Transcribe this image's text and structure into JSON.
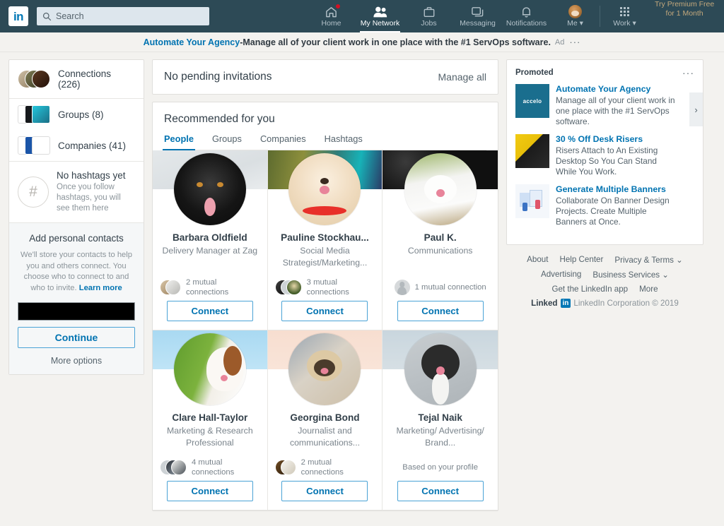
{
  "nav": {
    "logo_text": "in",
    "search_placeholder": "Search",
    "search_value": "",
    "items": [
      {
        "label": "Home",
        "icon": "home-icon",
        "badge": true,
        "active": false
      },
      {
        "label": "My Network",
        "icon": "people-icon",
        "badge": false,
        "active": true
      },
      {
        "label": "Jobs",
        "icon": "briefcase-icon",
        "badge": false,
        "active": false
      },
      {
        "label": "Messaging",
        "icon": "message-icon",
        "badge": false,
        "active": false
      },
      {
        "label": "Notifications",
        "icon": "bell-icon",
        "badge": false,
        "active": false
      },
      {
        "label": "Me ▾",
        "icon": "avatar-icon",
        "badge": false,
        "active": false
      },
      {
        "label": "Work ▾",
        "icon": "grid-icon",
        "badge": false,
        "active": false
      }
    ],
    "premium_line1": "Try Premium Free",
    "premium_line2": "for 1 Month"
  },
  "ad_banner": {
    "link_text": "Automate Your Agency",
    "separator": " - ",
    "body_text": "Manage all of your client work in one place with the #1 ServOps software.",
    "tag": "Ad",
    "menu": "···"
  },
  "sidebar": {
    "connections": {
      "label": "Connections (226)"
    },
    "groups": {
      "label": "Groups (8)"
    },
    "companies": {
      "label": "Companies (41)"
    },
    "hashtags": {
      "icon_glyph": "#",
      "title": "No hashtags yet",
      "subtitle": "Once you follow hashtags, you will see them here"
    },
    "contacts": {
      "title": "Add personal contacts",
      "body": "We'll store your contacts to help you and others connect. You choose who to connect to and who to invite.",
      "learn_more": "Learn more",
      "email_value": "",
      "email_placeholder": "",
      "continue_label": "Continue",
      "more_options_label": "More options"
    }
  },
  "main": {
    "invitations": {
      "title": "No pending invitations",
      "manage_all_label": "Manage all"
    },
    "recommended": {
      "title": "Recommended for you",
      "tabs": [
        {
          "label": "People",
          "active": true
        },
        {
          "label": "Groups",
          "active": false
        },
        {
          "label": "Companies",
          "active": false
        },
        {
          "label": "Hashtags",
          "active": false
        }
      ],
      "people": [
        {
          "name": "Barbara Oldfield",
          "headline": "Delivery Manager at Zag",
          "mutual_text": "2 mutual connections",
          "mutual_count": 2,
          "connect_label": "Connect",
          "cover_color": "#dfe3e6",
          "avatar_desc": "black dog photo"
        },
        {
          "name": "Pauline Stockhau...",
          "headline": "Social Media Strategist/Marketing...",
          "mutual_text": "3 mutual connections",
          "mutual_count": 3,
          "connect_label": "Connect",
          "cover_color": "#7d8a56",
          "avatar_desc": "pomeranian dog photo"
        },
        {
          "name": "Paul K.",
          "headline": "Communications",
          "mutual_text": "1 mutual connection",
          "mutual_count": 1,
          "connect_label": "Connect",
          "cover_color": "#1d1d1d",
          "avatar_desc": "white spitz dog photo"
        },
        {
          "name": "Clare Hall-Taylor",
          "headline": "Marketing & Research Professional",
          "mutual_text": "4 mutual connections",
          "mutual_count": 4,
          "connect_label": "Connect",
          "cover_color": "#b4dcf0",
          "avatar_desc": "cavalier spaniel photo"
        },
        {
          "name": "Georgina Bond",
          "headline": "Journalist and communications...",
          "mutual_text": "2 mutual connections",
          "mutual_count": 2,
          "connect_label": "Connect",
          "cover_color": "#f6ddd0",
          "avatar_desc": "pug photo"
        },
        {
          "name": "Tejal Naik",
          "headline": "Marketing/ Advertising/ Brand...",
          "mutual_text": "Based on your profile",
          "mutual_count": 0,
          "connect_label": "Connect",
          "cover_color": "#cdd8de",
          "avatar_desc": "border collie photo"
        }
      ]
    }
  },
  "promoted": {
    "label": "Promoted",
    "menu": "···",
    "next_arrow": "›",
    "items": [
      {
        "title": "Automate Your Agency",
        "desc": "Manage all of your client work in one place with the #1 ServOps software.",
        "thumb_label": "accelo",
        "thumb_color": "#1a6e8e"
      },
      {
        "title": "30 % Off Desk Risers",
        "desc": "Risers Attach to An Existing Desktop So You Can Stand While You Work.",
        "thumb_label": "",
        "thumb_color": "#f2cb12"
      },
      {
        "title": "Generate Multiple Banners",
        "desc": "Collaborate On Banner Design Projects. Create Multiple Banners at Once.",
        "thumb_label": "",
        "thumb_color": "#eef3fa"
      }
    ]
  },
  "footer": {
    "row1": [
      "About",
      "Help Center",
      "Privacy & Terms ⌄"
    ],
    "row2": [
      "Advertising",
      "Business Services ⌄"
    ],
    "row3": [
      "Get the LinkedIn app",
      "More"
    ],
    "brand_word": "Linked",
    "brand_mark": "in",
    "copyright": "LinkedIn Corporation © 2019"
  }
}
